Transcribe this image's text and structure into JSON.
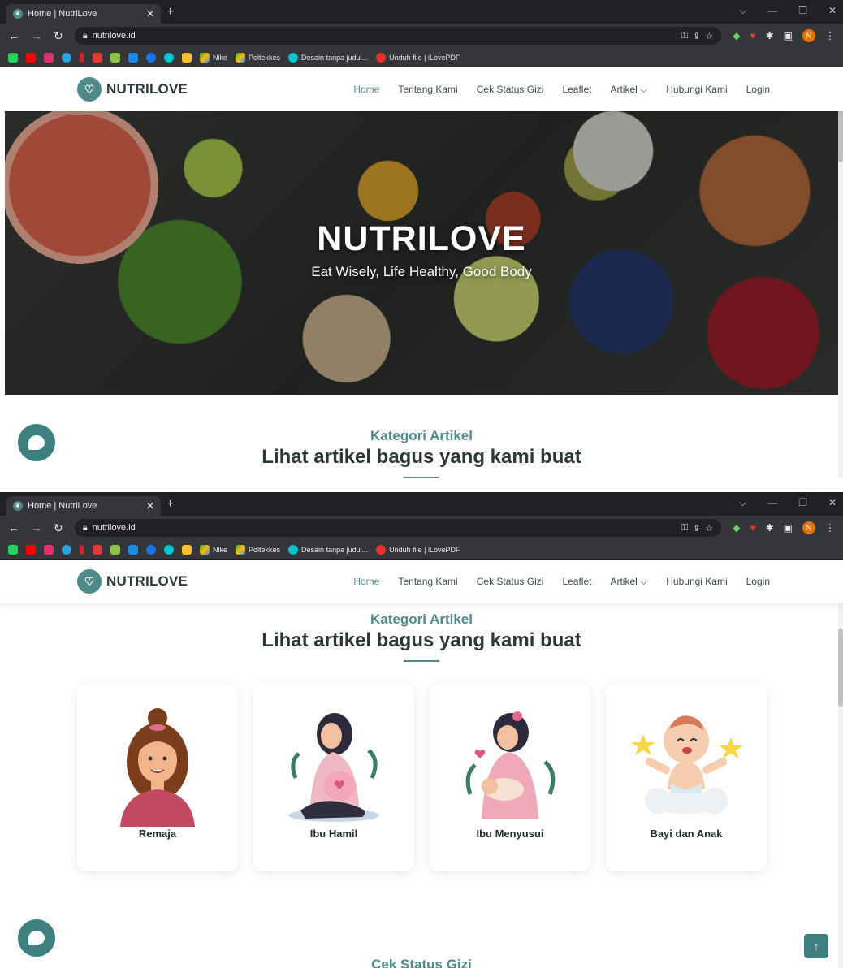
{
  "browser": {
    "tab_title": "Home | NutriLove",
    "url": "nutrilove.id",
    "bookmarks": [
      {
        "label": "Nike"
      },
      {
        "label": "Poltekkes"
      },
      {
        "label": "Desain tanpa judul..."
      },
      {
        "label": "Unduh file | iLovePDF"
      }
    ],
    "profile_initial": "N"
  },
  "site": {
    "brand": "NUTRILOVE",
    "nav": [
      "Home",
      "Tentang Kami",
      "Cek Status Gizi",
      "Leaflet",
      "Artikel ⌵",
      "Hubungi Kami",
      "Login"
    ],
    "hero_title": "NUTRILOVE",
    "hero_subtitle": "Eat Wisely, Life Healthy, Good Body",
    "section_subtitle": "Kategori Artikel",
    "section_title": "Lihat artikel bagus yang kami buat",
    "categories": [
      "Remaja",
      "Ibu Hamil",
      "Ibu Menyusui",
      "Bayi dan Anak"
    ],
    "next_section": "Cek Status Gizi"
  },
  "colors": {
    "accent": "#4f8a8b",
    "chrome_dark": "#202124",
    "chrome_mid": "#35363a"
  }
}
